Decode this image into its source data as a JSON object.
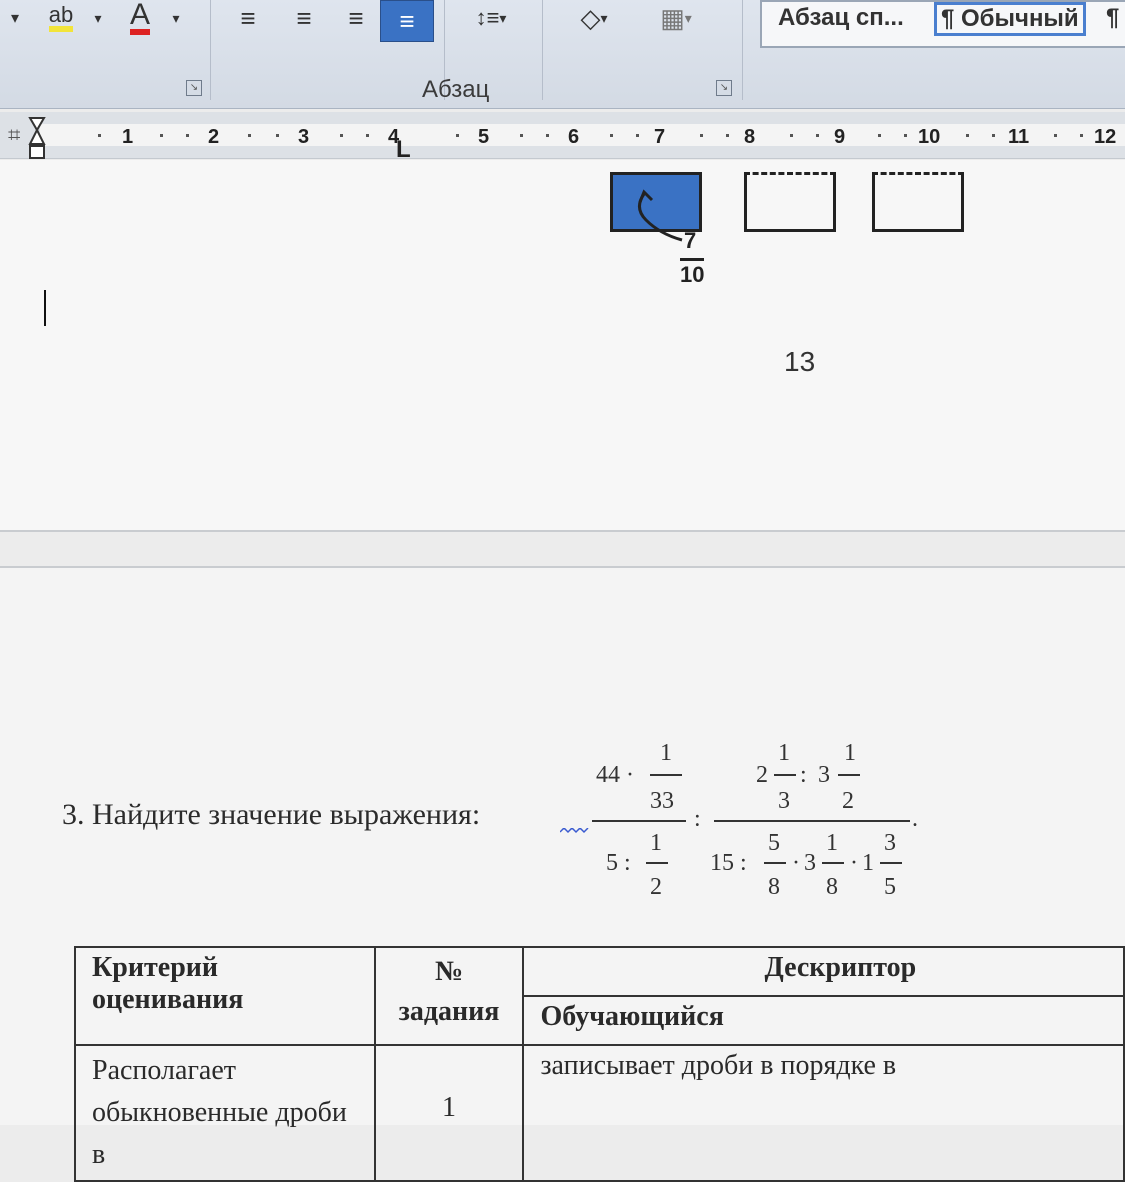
{
  "ribbon": {
    "buttons": [
      {
        "name": "highlight-color-icon",
        "glyph": "ab"
      },
      {
        "name": "font-color-icon",
        "glyph": "A"
      },
      {
        "name": "align-left-icon",
        "glyph": "≡"
      },
      {
        "name": "align-center-icon",
        "glyph": "≡"
      },
      {
        "name": "align-right-icon",
        "glyph": "≡"
      },
      {
        "name": "justify-icon",
        "glyph": "≡"
      },
      {
        "name": "line-spacing-icon",
        "glyph": "↕≡"
      },
      {
        "name": "shading-icon",
        "glyph": "◇"
      },
      {
        "name": "borders-icon",
        "glyph": "▦"
      }
    ],
    "group_label": "Абзац",
    "styles": [
      "Абзац сп...",
      "¶ Обычный",
      "¶"
    ],
    "accent_color": "#3a72c4"
  },
  "ruler": {
    "numbers": [
      "1",
      "2",
      "3",
      "4",
      "5",
      "6",
      "7",
      "8",
      "9",
      "10",
      "11",
      "12"
    ],
    "tab_marker": "L"
  },
  "upper_page": {
    "fraction_label": {
      "numerator": "7",
      "denominator": "10"
    },
    "page_number": "13"
  },
  "task": {
    "text": "3. Найдите значение выражения:",
    "expression": {
      "left_num": {
        "whole": "44 ·",
        "num": "1",
        "den": "33"
      },
      "left_den": {
        "whole": "5 :",
        "num": "1",
        "den": "2"
      },
      "op": ":",
      "right_num": {
        "a_whole": "2",
        "a_num": "1",
        "a_den": "3",
        "mid": ":",
        "b_whole": "3",
        "b_num": "1",
        "b_den": "2"
      },
      "right_den": {
        "lead": "15 :",
        "c_num": "5",
        "c_den": "8",
        "dot1": "·",
        "d_whole": "3",
        "d_num": "1",
        "d_den": "8",
        "dot2": "·",
        "e_whole": "1",
        "e_num": "3",
        "e_den": "5"
      },
      "end": "."
    }
  },
  "table": {
    "headers": {
      "criterion": "Критерий оценивания",
      "task_no_line1": "№",
      "task_no_line2": "задания",
      "descriptor": "Дескриптор",
      "learner": "Обучающийся"
    },
    "rows": [
      {
        "criterion_line1": "Располагает",
        "criterion_line2": "обыкновенные дроби в",
        "task_no": "1",
        "descriptor": "записывает дроби в порядке в"
      }
    ]
  }
}
